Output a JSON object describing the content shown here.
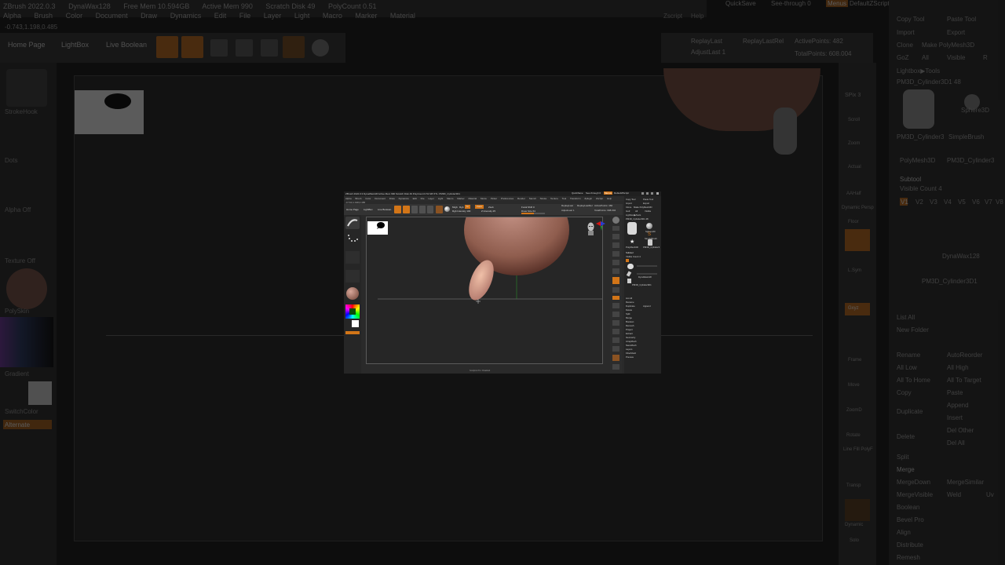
{
  "background": {
    "menu": [
      "ZBrush 2022.0.3",
      "DynaWax128",
      "Free Mem 10.594GB",
      "Active Mem 990",
      "Scratch Disk 49",
      "PolyCount 0.51"
    ],
    "menu_items": [
      "Alpha",
      "Brush",
      "Color",
      "Document",
      "Draw",
      "Dynamics",
      "Edit",
      "File",
      "Layer",
      "Light",
      "Macro",
      "Marker",
      "Material"
    ],
    "coords": "-0.743,1.198,0.485",
    "buttons": {
      "home_page": "Home Page",
      "lightbox": "LightBox",
      "live_boolean": "Live Boolean"
    },
    "left_labels": [
      "StrokeHook",
      "Dots",
      "Alpha Off",
      "Texture Off",
      "PolySkin",
      "Gradient",
      "SwitchColor",
      "Alternate"
    ],
    "right_top": {
      "quicksave": "QuickSave",
      "see_through": "See-through  0",
      "menus": "Menus",
      "default_zscript": "DefaultZScript",
      "zscript": "Zscript",
      "help": "Help",
      "replay_last": "ReplayLast",
      "replay_last_rel": "ReplayLastRel",
      "adjust_last": "AdjustLast 1",
      "active_points": "ActivePoints: 482",
      "total_points": "TotalPoints: 608.004"
    },
    "shelf_labels": [
      "SPix 3",
      "Scroll",
      "Zoom",
      "Actual",
      "AAHalf",
      "Dynamic Persp",
      "Floor",
      "L.Sym",
      "Gxyz",
      "Frame",
      "Move",
      "ZoomD",
      "Rotate",
      "Line Fill PolyF",
      "Transp",
      "Dynamic",
      "Solo"
    ],
    "rpanel": [
      "Copy Tool",
      "Paste Tool",
      "Import",
      "Export",
      "Clone",
      "Make PolyMesh3D",
      "GoZ",
      "All",
      "Visible",
      "R",
      "Lightbox▶Tools",
      "PM3D_Cylinder3D1  48",
      "Sphere3D",
      "PM3D_Cylinder3",
      "SimpleBrush",
      "PolyMesh3D",
      "PM3D_Cylinder3",
      "Subtool",
      "Visible Count 4",
      "V1",
      "V2",
      "V3",
      "V4",
      "V5",
      "V6",
      "V7",
      "V8",
      "DynaWax128",
      "PM3D_Cylinder3D1",
      "List All",
      "New Folder",
      "Rename",
      "AutoReorder",
      "All Low",
      "All High",
      "All To Home",
      "All To Target",
      "Copy",
      "Paste",
      "Duplicate",
      "Append",
      "Insert",
      "Delete",
      "Del Other",
      "Del All",
      "Split",
      "Merge",
      "MergeDown",
      "MergeSimilar",
      "MergeVisible",
      "Weld",
      "Uv",
      "Boolean",
      "Bevel Pro",
      "Align",
      "Distribute",
      "Remesh"
    ]
  },
  "window": {
    "title": "ZBrush 2022.0.3  DynaWax128  Active Mem 990  Scratch Disk 49  PolyCount 0.51 MP  ZTL: PM3D_Cylinder3D1",
    "menu_items": [
      "Alpha",
      "Brush",
      "Color",
      "Document",
      "Draw",
      "Dynamics",
      "Edit",
      "File",
      "Layer",
      "Light",
      "Macro",
      "Marker",
      "Material",
      "Movie",
      "Picker",
      "Preferences",
      "Render",
      "Stencil",
      "Stroke",
      "Texture",
      "Tool",
      "Transform",
      "Zplugin",
      "Zscript",
      "Help"
    ],
    "coords": "-0.743,1.198,0.485",
    "toolbar": {
      "home_page": "Home Page",
      "lightbox": "LightBox",
      "live_boolean": "Live Boolean",
      "mrgb": "Mrgb",
      "rgb": "Rgb",
      "m": "M",
      "zadd": "Zadd",
      "zsub": "Zsub",
      "focal_shift": "Focal Shift 0",
      "draw_size": "Draw Size 64",
      "rgb_intensity": "Rgb Intensity 100",
      "z_intensity": "Z Intensity 25",
      "replay_last": "ReplayLast",
      "replay_last_rel": "ReplayLastRel",
      "adjust_last": "AdjustLast 1",
      "active_points": "ActivePoints: 482",
      "total_points": "TotalPoints: 608.004",
      "quicksave": "QuickSave",
      "see_through": "See-through 0",
      "menus": "Menus",
      "default_zscript": "DefaultZScript"
    },
    "right_panel": [
      "Copy Tool",
      "Paste Tool",
      "Import",
      "Export",
      "Clone",
      "Make PolyMesh3D",
      "GoZ",
      "All",
      "Visible",
      "Lightbox▶Tools",
      "PM3D_Cylinder3D1  48",
      "Sphere3D",
      "SimpleBrush",
      "PolyMesh3D",
      "PM3D_Cylinder3",
      "Subtool",
      "Visible Count 4",
      "DynaWax128",
      "PM3D_Cylinder3D1",
      "List All",
      "Rename",
      "Duplicate",
      "Append",
      "Delete",
      "Split",
      "Merge",
      "Boolean",
      "Remesh",
      "Project",
      "Extract",
      "Geometry",
      "ArrayMesh",
      "NanoMesh",
      "Layers",
      "FiberMesh",
      "Preview"
    ],
    "status": "Sculptris Pro: Disabled"
  },
  "colors": {
    "accent": "#d27518",
    "skin": "#a46d5c",
    "axis_red": "#d01414",
    "axis_green": "#1fa82e",
    "axis_blue": "#2a3cd0"
  }
}
